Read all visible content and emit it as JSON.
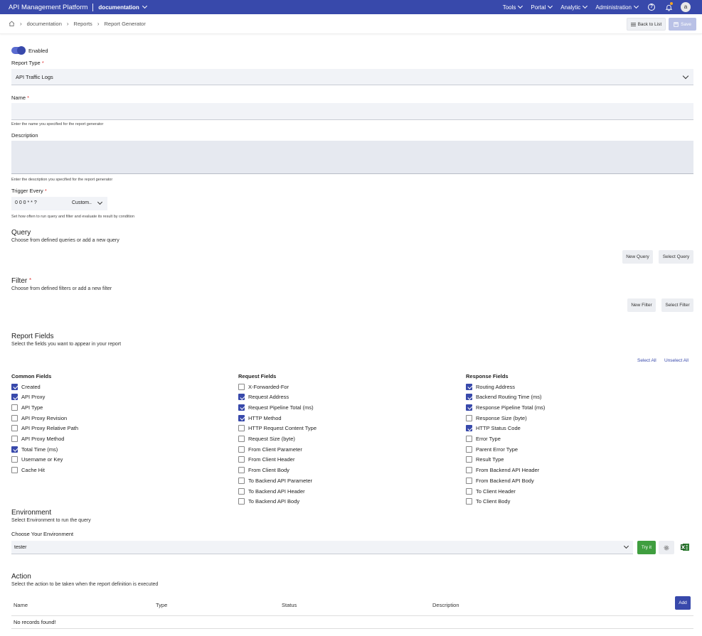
{
  "topbar": {
    "brand": "API Management Platform",
    "workspace": "documentation",
    "nav": [
      "Tools",
      "Portal",
      "Analytic",
      "Administration"
    ],
    "avatar": "a",
    "help_glyph": "?"
  },
  "breadcrumb": [
    "documentation",
    "Reports",
    "Report Generator"
  ],
  "actions": {
    "back": "Back to List",
    "save": "Save"
  },
  "form": {
    "enabled_label": "Enabled",
    "report_type_label": "Report Type",
    "report_type_value": "API Traffic Logs",
    "name_label": "Name",
    "name_hint": "Enter the name you specified for the report generator",
    "description_label": "Description",
    "description_hint": "Enter the description you specified for the report generator",
    "trigger_label": "Trigger Every",
    "trigger_value": "0 0 0 * * ?",
    "trigger_mode": "Custom..",
    "trigger_hint": "Set how often to run query and filter and evaluate its result by condition",
    "required_mark": "*"
  },
  "query": {
    "title": "Query",
    "subtitle": "Choose from defined queries or add a new query",
    "new": "New Query",
    "select": "Select Query"
  },
  "filter": {
    "title": "Filter",
    "subtitle": "Choose from defined filters or add a new filter",
    "new": "New Filter",
    "select": "Select Filter"
  },
  "report_fields": {
    "title": "Report Fields",
    "subtitle": "Select the fields you want to appear in your report",
    "select_all": "Select All",
    "unselect_all": "Unselect All",
    "columns": [
      {
        "title": "Common Fields",
        "items": [
          {
            "label": "Created",
            "checked": true
          },
          {
            "label": "API Proxy",
            "checked": true
          },
          {
            "label": "API Type",
            "checked": false
          },
          {
            "label": "API Proxy Revision",
            "checked": false
          },
          {
            "label": "API Proxy Relative Path",
            "checked": false
          },
          {
            "label": "API Proxy Method",
            "checked": false
          },
          {
            "label": "Total Time (ms)",
            "checked": true
          },
          {
            "label": "Username or Key",
            "checked": false
          },
          {
            "label": "Cache Hit",
            "checked": false
          }
        ]
      },
      {
        "title": "Request Fields",
        "items": [
          {
            "label": "X-Forwarded-For",
            "checked": false
          },
          {
            "label": "Request Address",
            "checked": true
          },
          {
            "label": "Request Pipeline Total (ms)",
            "checked": true
          },
          {
            "label": "HTTP Method",
            "checked": true
          },
          {
            "label": "HTTP Request Content Type",
            "checked": false
          },
          {
            "label": "Request Size (byte)",
            "checked": false
          },
          {
            "label": "From Client Parameter",
            "checked": false
          },
          {
            "label": "From Client Header",
            "checked": false
          },
          {
            "label": "From Client Body",
            "checked": false
          },
          {
            "label": "To Backend API Parameter",
            "checked": false
          },
          {
            "label": "To Backend API Header",
            "checked": false
          },
          {
            "label": "To Backend API Body",
            "checked": false
          }
        ]
      },
      {
        "title": "Response Fields",
        "items": [
          {
            "label": "Routing Address",
            "checked": true
          },
          {
            "label": "Backend Routing Time (ms)",
            "checked": true
          },
          {
            "label": "Response Pipeline Total (ms)",
            "checked": true
          },
          {
            "label": "Response Size (byte)",
            "checked": false
          },
          {
            "label": "HTTP Status Code",
            "checked": true
          },
          {
            "label": "Error Type",
            "checked": false
          },
          {
            "label": "Parent Error Type",
            "checked": false
          },
          {
            "label": "Result Type",
            "checked": false
          },
          {
            "label": "From Backend API Header",
            "checked": false
          },
          {
            "label": "From Backend API Body",
            "checked": false
          },
          {
            "label": "To Client Header",
            "checked": false
          },
          {
            "label": "To Client Body",
            "checked": false
          }
        ]
      }
    ]
  },
  "environment": {
    "title": "Environment",
    "subtitle": "Select Environment to run the query",
    "choose_label": "Choose Your Environment",
    "value": "tester",
    "try": "Try it"
  },
  "action": {
    "title": "Action",
    "subtitle": "Select the action to be taken when the report definition is executed",
    "add": "Add",
    "columns": [
      "Name",
      "Type",
      "Status",
      "Description"
    ],
    "empty": "No records found!"
  },
  "colors": {
    "primary": "#3849ab",
    "success": "#3f9e3f",
    "required": "#e03a3a"
  }
}
